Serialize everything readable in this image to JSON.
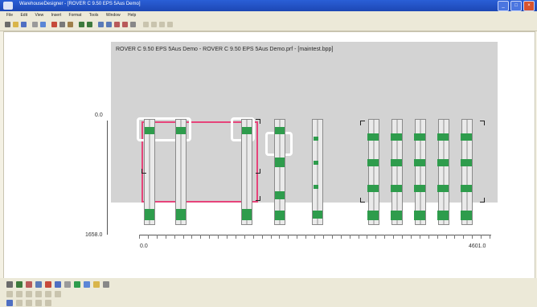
{
  "window": {
    "title": "WarehouseDesigner - [ROVER C 9.50 EPS 5Aus Demo]"
  },
  "menu": [
    "File",
    "Edit",
    "View",
    "Insert",
    "Format",
    "Tools",
    "Window",
    "Help"
  ],
  "drawing": {
    "title": "ROVER C 9.50 EPS 5Aus Demo - ROVER C 9.50 EPS 5Aus Demo.prf - [maintest.bpp]",
    "y_top_label": "0.0",
    "y_bottom_label": "1658.0",
    "x_left_label": "0.0",
    "x_right_label": "4601.0"
  },
  "colors": {
    "shelf": "#2e9c4c",
    "selection": "#e6447a",
    "panel": "#d3d3d3",
    "titlebar": "#1d47b4"
  }
}
